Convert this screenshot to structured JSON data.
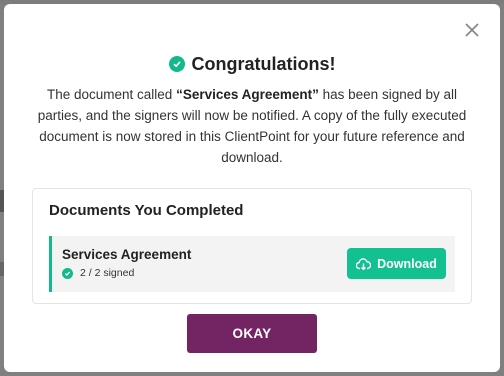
{
  "modal": {
    "title": "Congratulations!",
    "message_prefix": "The document called ",
    "document_quoted": "“Services Agreement”",
    "message_suffix": " has been signed by all parties, and the signers will now be notified. A copy of the fully executed document is now stored in this ClientPoint for your future reference and download.",
    "card_title": "Documents You Completed",
    "documents": [
      {
        "name": "Services Agreement",
        "status": "2 / 2 signed",
        "download_label": "Download"
      }
    ],
    "okay_label": "OKAY"
  },
  "colors": {
    "accent": "#13b989",
    "primary_button": "#732563"
  },
  "icons": {
    "close": "close-icon",
    "title": "check-circle-icon",
    "download": "cloud-download-icon"
  }
}
